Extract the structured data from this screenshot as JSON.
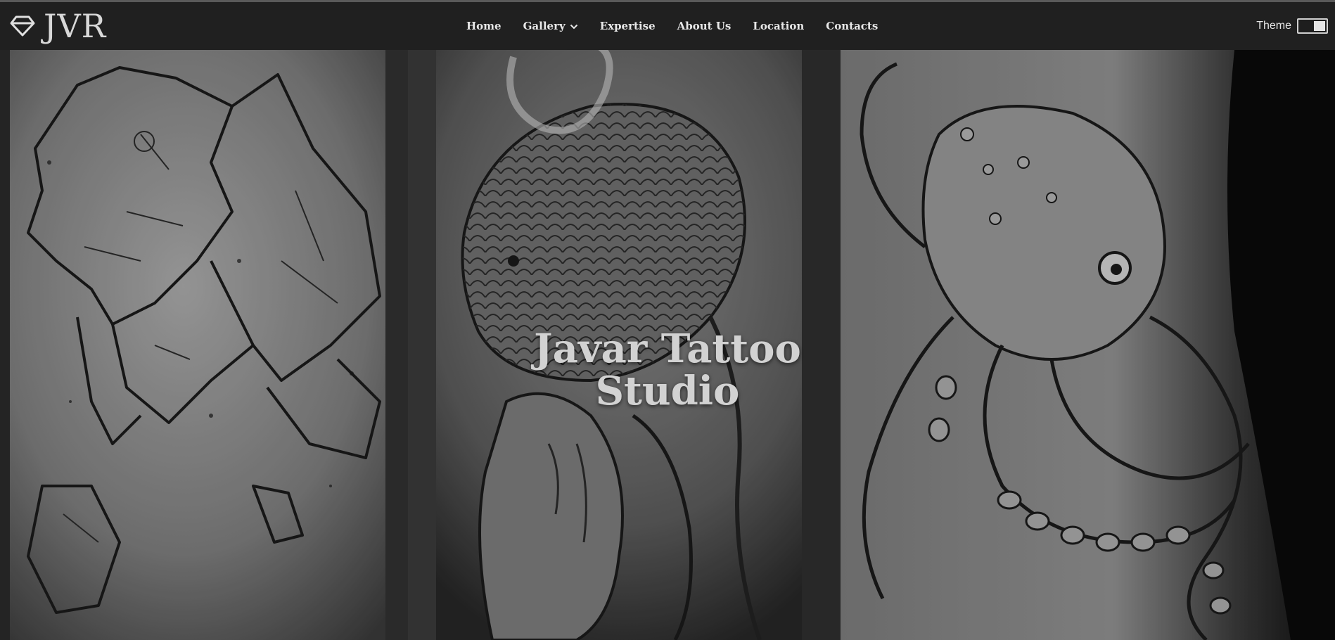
{
  "brand": {
    "logo_icon": "diamond-icon",
    "name": "JVR"
  },
  "nav": {
    "items": [
      {
        "label": "Home"
      },
      {
        "label": "Gallery",
        "icon": "chevron-down-icon"
      },
      {
        "label": "Expertise"
      },
      {
        "label": "About Us"
      },
      {
        "label": "Location"
      },
      {
        "label": "Contacts"
      }
    ]
  },
  "theme": {
    "label": "Theme",
    "state": "on"
  },
  "hero": {
    "title_line1": "Javar Tattoo",
    "title_line2": "Studio",
    "panels": [
      {
        "subject": "geometric fish tattoo"
      },
      {
        "subject": "snake tattoo"
      },
      {
        "subject": "octopus tattoo"
      }
    ]
  },
  "colors": {
    "navbar_bg": "#202020",
    "text": "#e8e8e8",
    "hero_title": "#d2d2d2"
  }
}
